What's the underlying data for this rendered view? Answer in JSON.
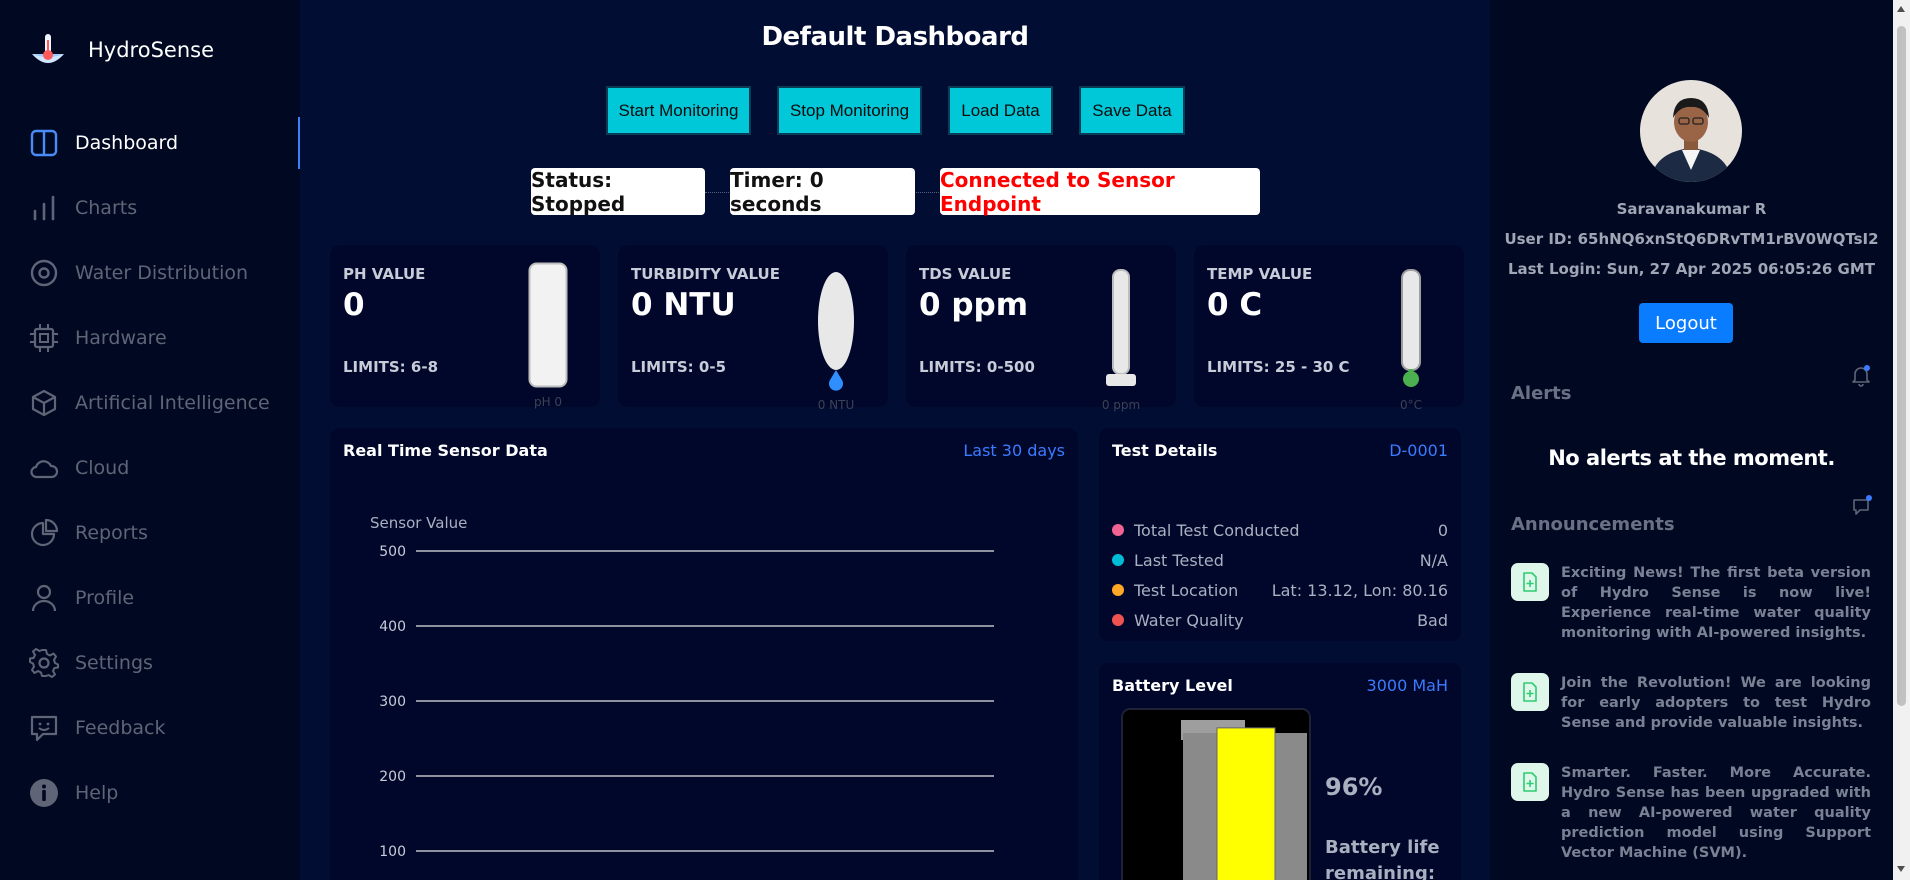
{
  "brand": {
    "name": "HydroSense"
  },
  "sidebar": {
    "items": [
      {
        "label": "Dashboard",
        "icon": "dashboard-icon"
      },
      {
        "label": "Charts",
        "icon": "chart-icon"
      },
      {
        "label": "Water Distribution",
        "icon": "target-icon"
      },
      {
        "label": "Hardware",
        "icon": "cpu-icon"
      },
      {
        "label": "Artificial Intelligence",
        "icon": "cube-icon"
      },
      {
        "label": "Cloud",
        "icon": "cloud-icon"
      },
      {
        "label": "Reports",
        "icon": "pie-icon"
      },
      {
        "label": "Profile",
        "icon": "user-icon"
      },
      {
        "label": "Settings",
        "icon": "gear-icon"
      },
      {
        "label": "Feedback",
        "icon": "feedback-icon"
      },
      {
        "label": "Help",
        "icon": "info-icon"
      }
    ]
  },
  "main": {
    "title": "Default Dashboard",
    "buttons": {
      "start": "Start Monitoring",
      "stop": "Stop Monitoring",
      "load": "Load Data",
      "save": "Save Data"
    },
    "status": {
      "state": "Status: Stopped",
      "timer": "Timer: 0 seconds",
      "connection": "Connected to Sensor Endpoint"
    },
    "sensors": {
      "ph": {
        "label": "PH VALUE",
        "value": "0",
        "limits": "LIMITS: 6-8",
        "gauge_caption": "pH 0"
      },
      "turbidity": {
        "label": "TURBIDITY VALUE",
        "value": "0 NTU",
        "limits": "LIMITS: 0-5",
        "gauge_caption": "0 NTU"
      },
      "tds": {
        "label": "TDS VALUE",
        "value": "0 ppm",
        "limits": "LIMITS: 0-500",
        "gauge_caption": "0 ppm"
      },
      "temp": {
        "label": "TEMP VALUE",
        "value": "0 C",
        "limits": "LIMITS: 25 - 30 C",
        "gauge_caption": "0°C"
      }
    },
    "realtime": {
      "title": "Real Time Sensor Data",
      "range_link": "Last 30 days"
    },
    "test_details": {
      "title": "Test Details",
      "id": "D-0001",
      "rows": [
        {
          "label": "Total Test Conducted",
          "value": "0",
          "color": "#f06292"
        },
        {
          "label": "Last Tested",
          "value": "N/A",
          "color": "#00bcd4"
        },
        {
          "label": "Test Location",
          "value": "Lat: 13.12, Lon: 80.16",
          "color": "#ffa726"
        },
        {
          "label": "Water Quality",
          "value": "Bad",
          "color": "#ef5350"
        }
      ]
    },
    "battery": {
      "title": "Battery Level",
      "capacity": "3000 MaH",
      "percent": "96%",
      "life_label": "Battery life remaining:",
      "level": 0.96
    }
  },
  "chart_data": {
    "type": "line",
    "ylabel": "Sensor Value",
    "y_ticks": [
      500,
      400,
      300,
      200,
      100
    ],
    "series": [],
    "grid": true
  },
  "profile": {
    "name": "Saravanakumar R",
    "user_id": "User ID: 65hNQ6xnStQ6DRvTM1rBV0WQTsI2",
    "last_login": "Last Login: Sun, 27 Apr 2025 06:05:26 GMT",
    "logout": "Logout"
  },
  "alerts": {
    "title": "Alerts",
    "empty": "No alerts at the moment."
  },
  "announcements": {
    "title": "Announcements",
    "items": [
      "Exciting News! The first beta version of Hydro Sense is now live! Experience real-time water quality monitoring with AI-powered insights.",
      "Join the Revolution! We are looking for early adopters to test Hydro Sense and provide valuable insights.",
      "Smarter. Faster. More Accurate. Hydro Sense has been upgraded with a new AI-powered water quality prediction model using Support Vector Machine (SVM)."
    ]
  }
}
